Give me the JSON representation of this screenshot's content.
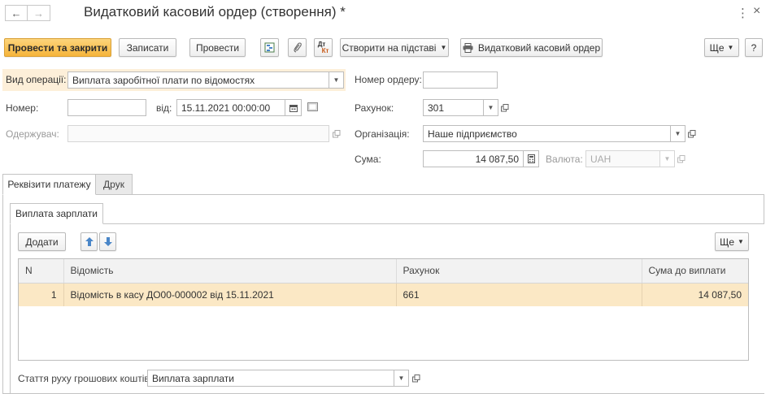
{
  "window": {
    "title": "Видатковий касовий ордер (створення) *",
    "more_icon": "more-vertical-icon",
    "close_icon": "close-icon"
  },
  "toolbar": {
    "post_and_close": "Провести та закрити",
    "save": "Записати",
    "post": "Провести",
    "create_based_on": "Створити на підставі",
    "print_order": "Видатковий касовий ордер",
    "more": "Ще",
    "help": "?",
    "dtkt_top": "Дт",
    "dtkt_bottom": "Кт"
  },
  "form": {
    "operation_label": "Вид операції:",
    "operation_value": "Виплата заробітної плати по відомостях",
    "order_number_label": "Номер ордеру:",
    "order_number_value": "",
    "number_label": "Номер:",
    "number_value": "",
    "date_label": "від:",
    "date_value": "15.11.2021 00:00:00",
    "account_label": "Рахунок:",
    "account_value": "301",
    "recipient_label": "Одержувач:",
    "recipient_value": "",
    "organization_label": "Організація:",
    "organization_value": "Наше підприємство",
    "amount_label": "Сума:",
    "amount_value": "14 087,50",
    "currency_label": "Валюта:",
    "currency_value": "UAH"
  },
  "tabs": [
    {
      "label": "Реквізити платежу",
      "active": true
    },
    {
      "label": "Друк",
      "active": false
    }
  ],
  "subtabs": [
    {
      "label": "Виплата зарплати",
      "active": true
    }
  ],
  "table_toolbar": {
    "add": "Додати",
    "more": "Ще"
  },
  "table": {
    "columns": [
      "N",
      "Відомість",
      "Рахунок",
      "Сума до виплати"
    ],
    "rows": [
      {
        "n": "1",
        "statement": "Відомість в касу ДО00-000002 від 15.11.2021",
        "account": "661",
        "amount": "14 087,50"
      }
    ]
  },
  "cashflow": {
    "label": "Стаття руху грошових коштів:",
    "value": "Виплата зарплати"
  },
  "colors": {
    "accent": "#f5b43b",
    "row_highlight": "#fbe8c5",
    "arrow_blue": "#4a86c8"
  }
}
